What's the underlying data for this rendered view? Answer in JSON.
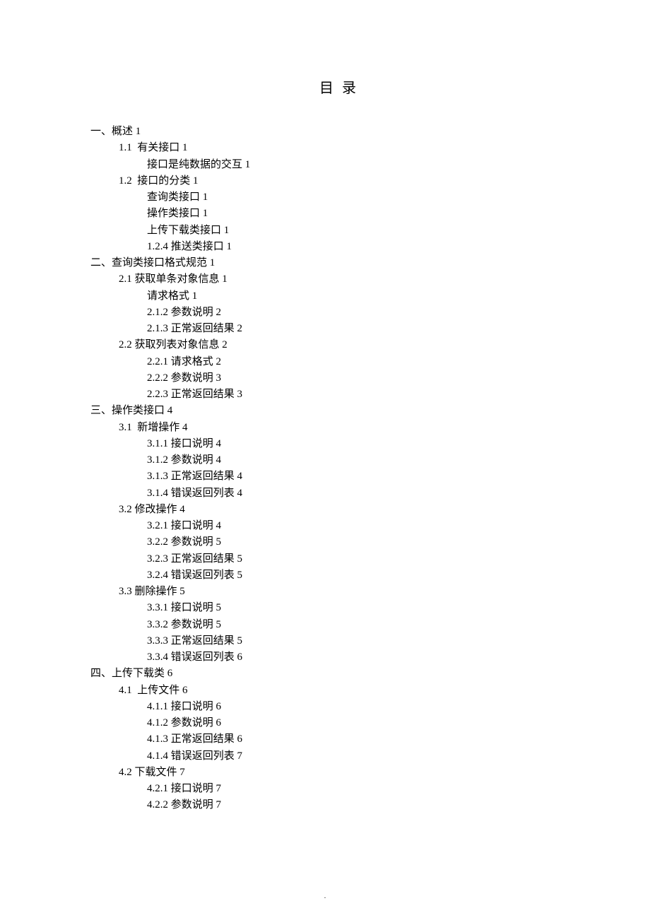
{
  "title": "目录",
  "footer": ".",
  "toc": [
    {
      "level": 0,
      "text": "一、概述 1"
    },
    {
      "level": 1,
      "text": "1.1  有关接口 1"
    },
    {
      "level": 2,
      "text": "接口是纯数据的交互 1"
    },
    {
      "level": 1,
      "text": "1.2  接口的分类 1"
    },
    {
      "level": 2,
      "text": "查询类接口 1"
    },
    {
      "level": 2,
      "text": "操作类接口 1"
    },
    {
      "level": 2,
      "text": "上传下载类接口 1"
    },
    {
      "level": 2,
      "text": "1.2.4 推送类接口 1"
    },
    {
      "level": 0,
      "text": "二、查询类接口格式规范 1"
    },
    {
      "level": 1,
      "text": "2.1 获取单条对象信息 1"
    },
    {
      "level": 2,
      "text": "请求格式 1"
    },
    {
      "level": 2,
      "text": "2.1.2 参数说明 2"
    },
    {
      "level": 2,
      "text": "2.1.3 正常返回结果 2"
    },
    {
      "level": 1,
      "text": "2.2 获取列表对象信息 2"
    },
    {
      "level": 2,
      "text": "2.2.1 请求格式 2"
    },
    {
      "level": 2,
      "text": "2.2.2 参数说明 3"
    },
    {
      "level": 2,
      "text": "2.2.3 正常返回结果 3"
    },
    {
      "level": 0,
      "text": "三、操作类接口 4"
    },
    {
      "level": 1,
      "text": "3.1  新增操作 4"
    },
    {
      "level": 2,
      "text": "3.1.1 接口说明 4"
    },
    {
      "level": 2,
      "text": "3.1.2 参数说明 4"
    },
    {
      "level": 2,
      "text": "3.1.3 正常返回结果 4"
    },
    {
      "level": 2,
      "text": "3.1.4 错误返回列表 4"
    },
    {
      "level": 1,
      "text": "3.2 修改操作 4"
    },
    {
      "level": 2,
      "text": "3.2.1 接口说明 4"
    },
    {
      "level": 2,
      "text": "3.2.2 参数说明 5"
    },
    {
      "level": 2,
      "text": "3.2.3 正常返回结果 5"
    },
    {
      "level": 2,
      "text": "3.2.4 错误返回列表 5"
    },
    {
      "level": 1,
      "text": "3.3 删除操作 5"
    },
    {
      "level": 2,
      "text": "3.3.1 接口说明 5"
    },
    {
      "level": 2,
      "text": "3.3.2 参数说明 5"
    },
    {
      "level": 2,
      "text": "3.3.3 正常返回结果 5"
    },
    {
      "level": 2,
      "text": "3.3.4 错误返回列表 6"
    },
    {
      "level": 0,
      "text": "四、上传下载类 6"
    },
    {
      "level": 1,
      "text": "4.1  上传文件 6"
    },
    {
      "level": 2,
      "text": "4.1.1 接口说明 6"
    },
    {
      "level": 2,
      "text": "4.1.2 参数说明 6"
    },
    {
      "level": 2,
      "text": "4.1.3 正常返回结果 6"
    },
    {
      "level": 2,
      "text": "4.1.4 错误返回列表 7"
    },
    {
      "level": 1,
      "text": "4.2 下载文件 7"
    },
    {
      "level": 2,
      "text": "4.2.1 接口说明 7"
    },
    {
      "level": 2,
      "text": "4.2.2 参数说明 7"
    }
  ]
}
